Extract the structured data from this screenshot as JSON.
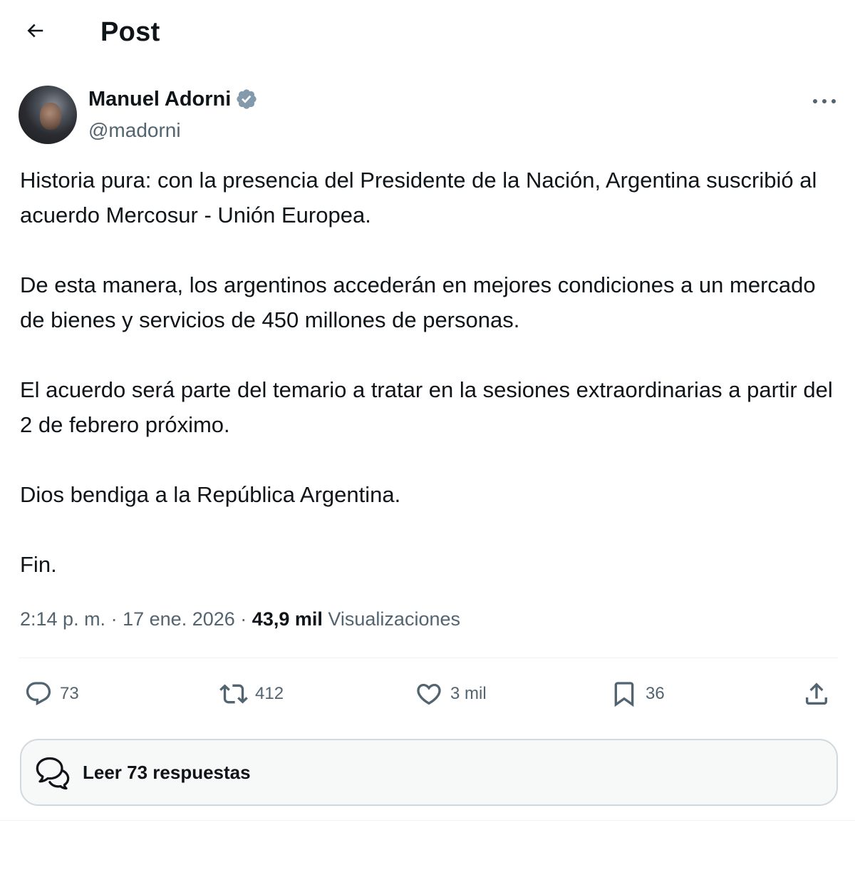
{
  "header": {
    "title": "Post",
    "back_icon": "arrow-left-icon"
  },
  "author": {
    "name": "Manuel Adorni",
    "handle": "@madorni",
    "verified": true,
    "verified_color": "#829aab"
  },
  "tweet": {
    "paragraphs": [
      "Historia pura: con la presencia del Presidente de la Nación, Argentina suscribió al acuerdo Mercosur - Unión Europea.",
      "De esta manera, los argentinos accederán en mejores condiciones a un mercado de bienes y servicios de 450 millones de personas.",
      "El acuerdo será parte del temario a tratar en la sesiones extraordinarias a partir del 2 de febrero próximo.",
      "Dios bendiga a la República Argentina.",
      "Fin."
    ]
  },
  "meta": {
    "time": "2:14 p. m.",
    "separator": "·",
    "date": "17 ene. 2026",
    "views_count": "43,9 mil",
    "views_label": "Visualizaciones"
  },
  "actions": {
    "replies": "73",
    "reposts": "412",
    "likes": "3 mil",
    "bookmarks": "36"
  },
  "read_replies": {
    "label": "Leer 73 respuestas"
  },
  "colors": {
    "text_primary": "#0f1419",
    "text_secondary": "#536471",
    "border": "#cfd9de"
  }
}
